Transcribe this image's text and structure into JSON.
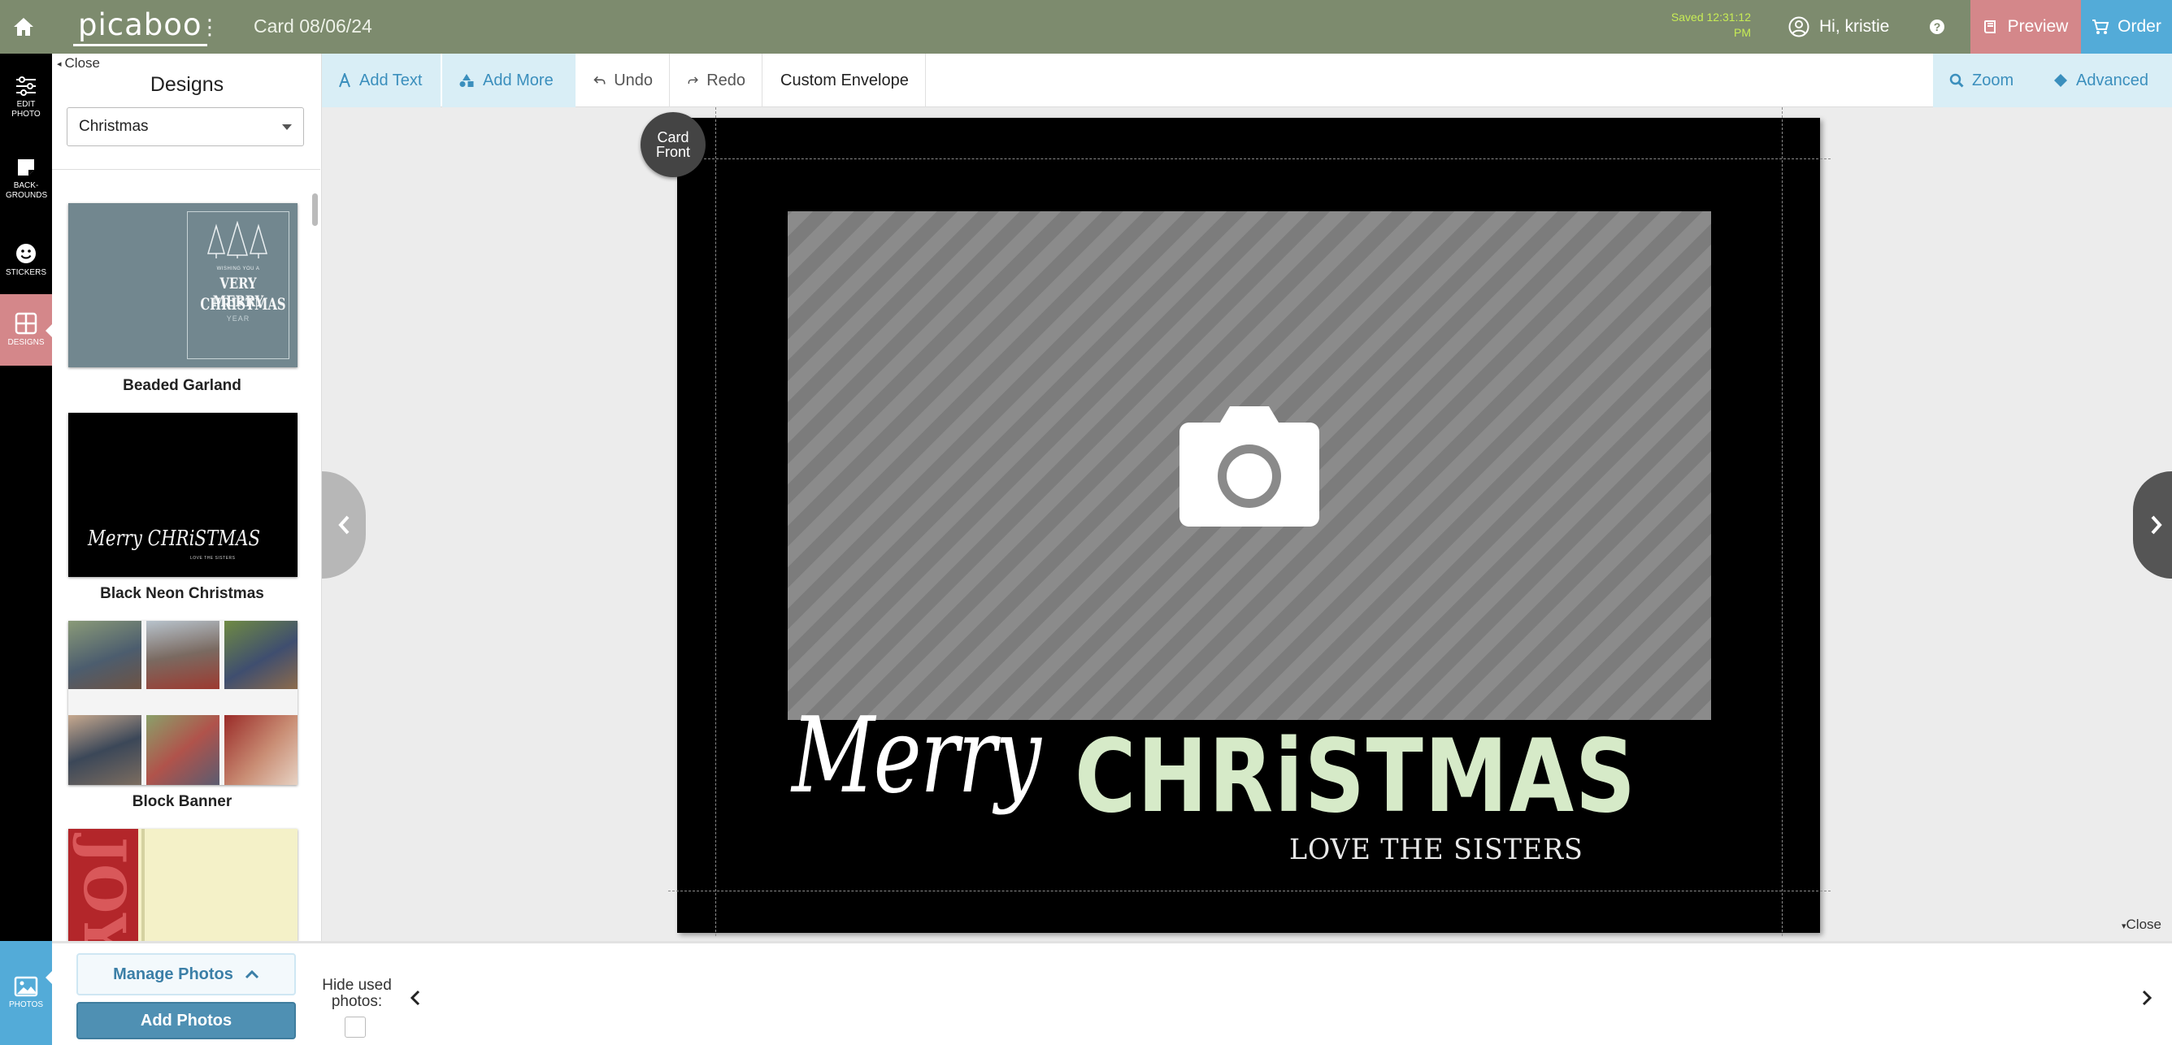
{
  "app": {
    "logo": "picaboo",
    "title": "Card 08/06/24",
    "saved": "Saved 12:31:12 PM"
  },
  "header": {
    "user": "Hi, kristie",
    "preview": "Preview",
    "order": "Order"
  },
  "rail": [
    {
      "label": "EDIT PHOTO",
      "icon": "sliders-icon"
    },
    {
      "label": "BACK-GROUNDS",
      "icon": "backgrounds-icon"
    },
    {
      "label": "STICKERS",
      "icon": "smiley-icon"
    },
    {
      "label": "DESIGNS",
      "icon": "grid-icon"
    },
    {
      "label": "PHOTOS",
      "icon": "image-icon"
    }
  ],
  "panel": {
    "close": "Close",
    "title": "Designs",
    "filter_selected": "Christmas",
    "designs": [
      {
        "name": "Beaded Garland",
        "line1": "WISHING YOU A",
        "line2": "VERY MERRY",
        "line3": "CHRISTMAS",
        "line4": "YEAR"
      },
      {
        "name": "Black Neon Christmas",
        "line1": "Merry CHRiSTMAS",
        "line2": "LOVE THE SISTERS"
      },
      {
        "name": "Block Banner"
      },
      {
        "name": "",
        "line1": "JOY"
      }
    ]
  },
  "toolbar": {
    "add_text": "Add Text",
    "add_more": "Add More",
    "undo": "Undo",
    "redo": "Redo",
    "custom_envelope": "Custom Envelope",
    "zoom": "Zoom",
    "advanced": "Advanced"
  },
  "canvas": {
    "badge": "Card Front",
    "merry": "Merry",
    "christmas": "CHRiSTMAS",
    "signature": "LOVE THE SISTERS"
  },
  "tray": {
    "close": "Close",
    "manage_photos": "Manage Photos",
    "add_photos": "Add Photos",
    "hide_used": "Hide used photos:"
  },
  "colors": {
    "topbar": "#7d8b6e",
    "designs_accent": "#d4878a",
    "order_blue": "#53abd8",
    "christmas_green": "#d6eac8"
  }
}
